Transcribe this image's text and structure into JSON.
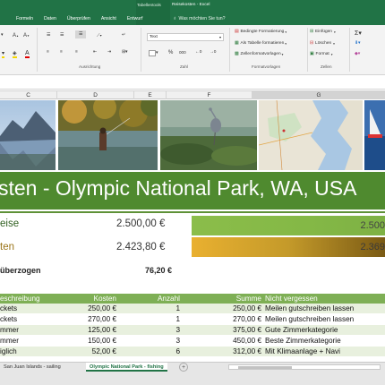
{
  "window": {
    "title": "Reisekosten - Excel",
    "context_tools": "Tabellentools"
  },
  "tabs": [
    "",
    "Formeln",
    "Daten",
    "Überprüfen",
    "Ansicht",
    "Entwurf"
  ],
  "tell_me": "Was möchten Sie tun?",
  "ribbon": {
    "number_format": "Text",
    "groups": {
      "alignment": "Ausrichtung",
      "number": "Zahl",
      "styles": "Formatvorlagen",
      "cells": "Zellen"
    },
    "styles": {
      "conditional": "Bedingte Formatierung",
      "as_table": "Als Tabelle formatieren",
      "cell_styles": "Zellenformatvorlagen"
    },
    "cells": {
      "insert": "Einfügen",
      "delete": "Löschen",
      "format": "Format"
    },
    "number_symbols": {
      "percent": "%",
      "thousands": "000"
    }
  },
  "columns": [
    "C",
    "D",
    "E",
    "F",
    "G"
  ],
  "banner_title": "sten - Olympic National Park, WA, USA",
  "summary": {
    "row1_label": "eise",
    "row1_value": "2.500,00 €",
    "row1_bar": "2.500",
    "row2_label": "ten",
    "row2_value": "2.423,80 €",
    "row2_bar": "2.369",
    "row3_label": "überzogen",
    "row3_value": "76,20 €"
  },
  "table": {
    "headers": {
      "beschreibung": "eschreibung",
      "kosten": "Kosten",
      "anzahl": "Anzahl",
      "summe": "Summe",
      "nicht": "Nicht vergessen"
    },
    "rows": [
      {
        "a": "ckets",
        "kosten": "250,00 €",
        "anzahl": "1",
        "summe": "250,00 €",
        "nicht": "Meilen gutschreiben lassen"
      },
      {
        "a": "ckets",
        "kosten": "270,00 €",
        "anzahl": "1",
        "summe": "270,00 €",
        "nicht": "Meilen gutschreiben lassen"
      },
      {
        "a": "mmer",
        "kosten": "125,00 €",
        "anzahl": "3",
        "summe": "375,00 €",
        "nicht": "Gute Zimmerkategorie"
      },
      {
        "a": "mmer",
        "kosten": "150,00 €",
        "anzahl": "3",
        "summe": "450,00 €",
        "nicht": "Beste Zimmerkategorie"
      },
      {
        "a": "iglich",
        "kosten": "52,00 €",
        "anzahl": "6",
        "summe": "312,00 €",
        "nicht": "Mit Klimaanlage + Navi"
      },
      {
        "a": "",
        "kosten": "",
        "anzahl": "",
        "summe": "",
        "nicht": ""
      }
    ]
  },
  "sheet_tabs": [
    "San Juan Islands - sailing",
    "Olympic National Park - fishing"
  ],
  "colors": {
    "excel_green": "#217346",
    "banner_green": "#4f8a2f",
    "header_green": "#7eaf55",
    "alt_row": "#e8f0de"
  }
}
